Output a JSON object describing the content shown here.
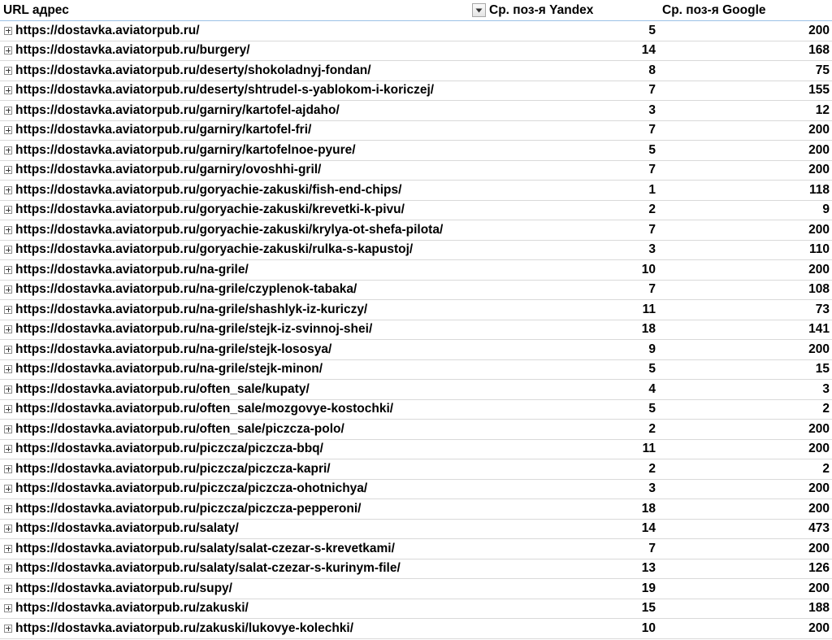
{
  "headers": {
    "url": "URL адрес",
    "yandex": "Ср. поз-я Yandex",
    "google": "Ср. поз-я Google"
  },
  "rows": [
    {
      "url": "https://dostavka.aviatorpub.ru/",
      "yandex": "5",
      "google": "200"
    },
    {
      "url": "https://dostavka.aviatorpub.ru/burgery/",
      "yandex": "14",
      "google": "168"
    },
    {
      "url": "https://dostavka.aviatorpub.ru/deserty/shokoladnyj-fondan/",
      "yandex": "8",
      "google": "75"
    },
    {
      "url": "https://dostavka.aviatorpub.ru/deserty/shtrudel-s-yablokom-i-koriczej/",
      "yandex": "7",
      "google": "155"
    },
    {
      "url": "https://dostavka.aviatorpub.ru/garniry/kartofel-ajdaho/",
      "yandex": "3",
      "google": "12"
    },
    {
      "url": "https://dostavka.aviatorpub.ru/garniry/kartofel-fri/",
      "yandex": "7",
      "google": "200"
    },
    {
      "url": "https://dostavka.aviatorpub.ru/garniry/kartofelnoe-pyure/",
      "yandex": "5",
      "google": "200"
    },
    {
      "url": "https://dostavka.aviatorpub.ru/garniry/ovoshhi-gril/",
      "yandex": "7",
      "google": "200"
    },
    {
      "url": "https://dostavka.aviatorpub.ru/goryachie-zakuski/fish-end-chips/",
      "yandex": "1",
      "google": "118"
    },
    {
      "url": "https://dostavka.aviatorpub.ru/goryachie-zakuski/krevetki-k-pivu/",
      "yandex": "2",
      "google": "9"
    },
    {
      "url": "https://dostavka.aviatorpub.ru/goryachie-zakuski/krylya-ot-shefa-pilota/",
      "yandex": "7",
      "google": "200"
    },
    {
      "url": "https://dostavka.aviatorpub.ru/goryachie-zakuski/rulka-s-kapustoj/",
      "yandex": "3",
      "google": "110"
    },
    {
      "url": "https://dostavka.aviatorpub.ru/na-grile/",
      "yandex": "10",
      "google": "200"
    },
    {
      "url": "https://dostavka.aviatorpub.ru/na-grile/czyplenok-tabaka/",
      "yandex": "7",
      "google": "108"
    },
    {
      "url": "https://dostavka.aviatorpub.ru/na-grile/shashlyk-iz-kuriczy/",
      "yandex": "11",
      "google": "73"
    },
    {
      "url": "https://dostavka.aviatorpub.ru/na-grile/stejk-iz-svinnoj-shei/",
      "yandex": "18",
      "google": "141"
    },
    {
      "url": "https://dostavka.aviatorpub.ru/na-grile/stejk-lososya/",
      "yandex": "9",
      "google": "200"
    },
    {
      "url": "https://dostavka.aviatorpub.ru/na-grile/stejk-minon/",
      "yandex": "5",
      "google": "15"
    },
    {
      "url": "https://dostavka.aviatorpub.ru/often_sale/kupaty/",
      "yandex": "4",
      "google": "3"
    },
    {
      "url": "https://dostavka.aviatorpub.ru/often_sale/mozgovye-kostochki/",
      "yandex": "5",
      "google": "2"
    },
    {
      "url": "https://dostavka.aviatorpub.ru/often_sale/piczcza-polo/",
      "yandex": "2",
      "google": "200"
    },
    {
      "url": "https://dostavka.aviatorpub.ru/piczcza/piczcza-bbq/",
      "yandex": "11",
      "google": "200"
    },
    {
      "url": "https://dostavka.aviatorpub.ru/piczcza/piczcza-kapri/",
      "yandex": "2",
      "google": "2"
    },
    {
      "url": "https://dostavka.aviatorpub.ru/piczcza/piczcza-ohotnichya/",
      "yandex": "3",
      "google": "200"
    },
    {
      "url": "https://dostavka.aviatorpub.ru/piczcza/piczcza-pepperoni/",
      "yandex": "18",
      "google": "200"
    },
    {
      "url": "https://dostavka.aviatorpub.ru/salaty/",
      "yandex": "14",
      "google": "473"
    },
    {
      "url": "https://dostavka.aviatorpub.ru/salaty/salat-czezar-s-krevetkami/",
      "yandex": "7",
      "google": "200"
    },
    {
      "url": "https://dostavka.aviatorpub.ru/salaty/salat-czezar-s-kurinym-file/",
      "yandex": "13",
      "google": "126"
    },
    {
      "url": "https://dostavka.aviatorpub.ru/supy/",
      "yandex": "19",
      "google": "200"
    },
    {
      "url": "https://dostavka.aviatorpub.ru/zakuski/",
      "yandex": "15",
      "google": "188"
    },
    {
      "url": "https://dostavka.aviatorpub.ru/zakuski/lukovye-kolechki/",
      "yandex": "10",
      "google": "200"
    }
  ],
  "icons": {
    "filter": "dropdown-filter-icon",
    "expand": "expand-plus-icon"
  }
}
